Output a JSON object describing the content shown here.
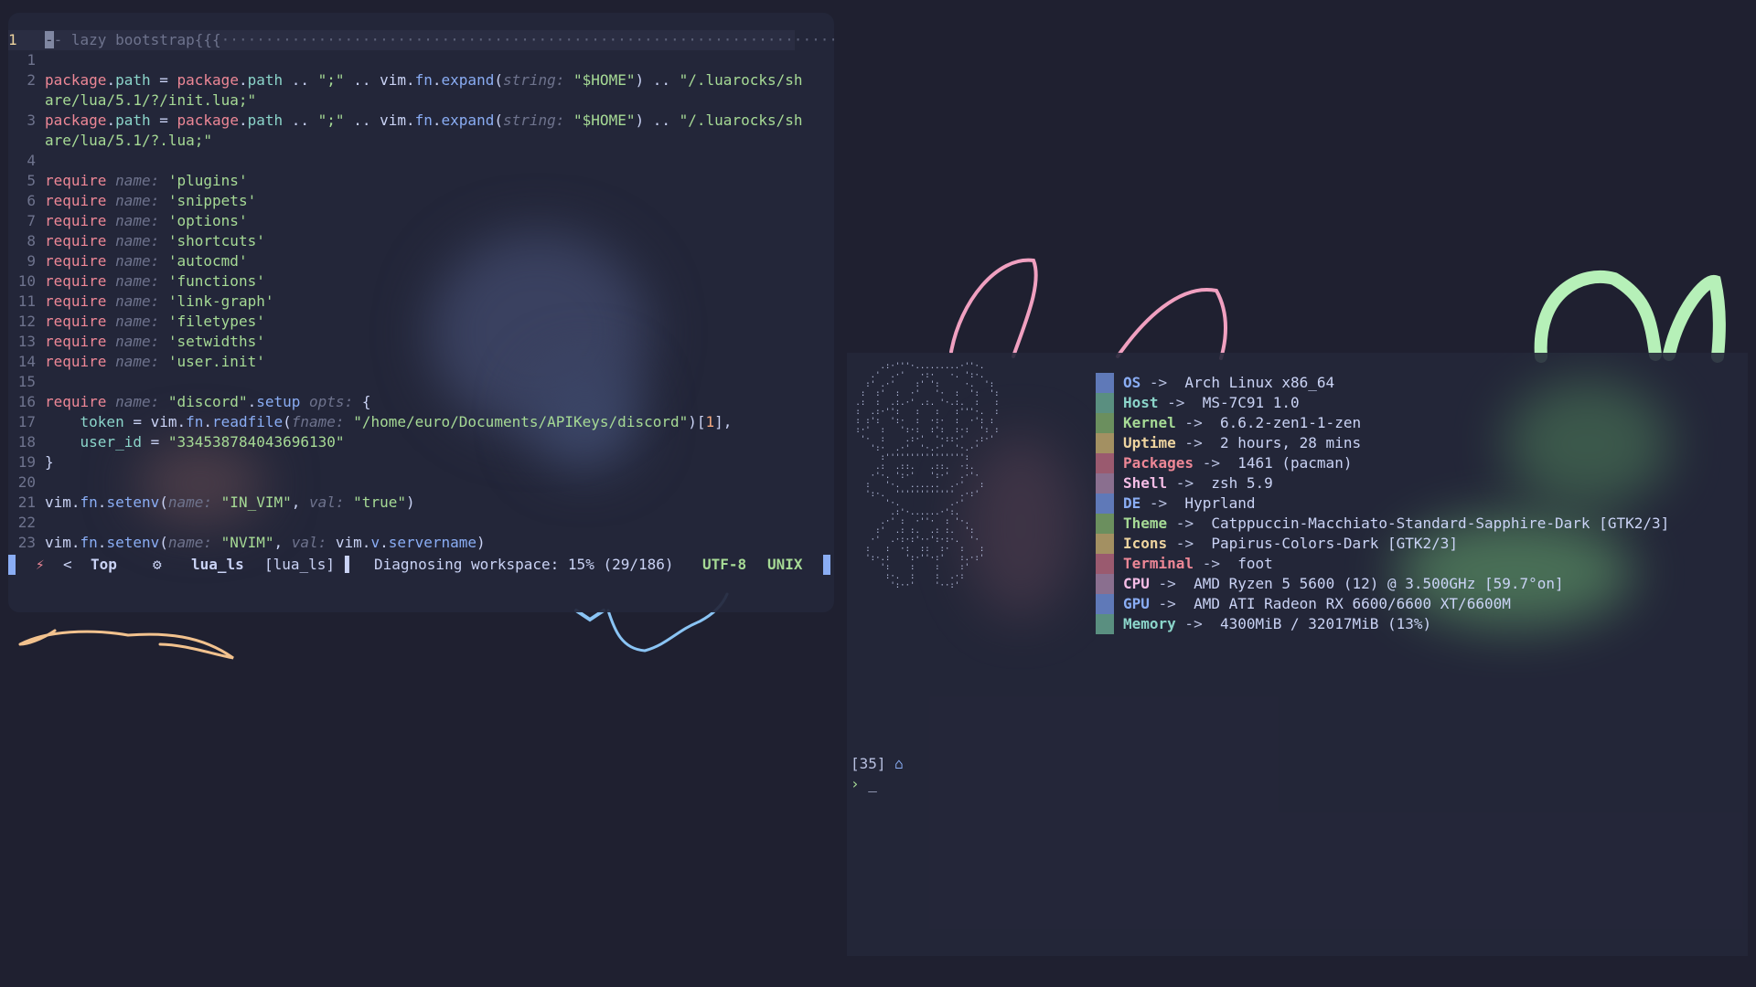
{
  "editor": {
    "lines": [
      {
        "n": "1",
        "current": true,
        "parts": [
          [
            "cursor",
            "-"
          ],
          [
            "cmt",
            "- lazy bootstrap{{{"
          ],
          [
            "dots",
            "·······································································"
          ]
        ]
      },
      {
        "n": "1",
        "parts": []
      },
      {
        "n": "2",
        "parts": [
          [
            "kw",
            "package"
          ],
          [
            "var",
            "."
          ],
          [
            "field",
            "path"
          ],
          [
            "var",
            " = "
          ],
          [
            "kw",
            "package"
          ],
          [
            "var",
            "."
          ],
          [
            "field",
            "path"
          ],
          [
            "var",
            " .. "
          ],
          [
            "str",
            "\";\""
          ],
          [
            "var",
            " .. vim."
          ],
          [
            "fn",
            "fn"
          ],
          [
            "var",
            "."
          ],
          [
            "fn",
            "expand"
          ],
          [
            "var",
            "("
          ],
          [
            "hint",
            "string: "
          ],
          [
            "str",
            "\"$HOME\""
          ],
          [
            "var",
            ") .. "
          ],
          [
            "str",
            "\"/.luarocks/sh"
          ]
        ]
      },
      {
        "n": "",
        "parts": [
          [
            "str",
            "are/lua/5.1/?/init.lua;\""
          ]
        ]
      },
      {
        "n": "3",
        "parts": [
          [
            "kw",
            "package"
          ],
          [
            "var",
            "."
          ],
          [
            "field",
            "path"
          ],
          [
            "var",
            " = "
          ],
          [
            "kw",
            "package"
          ],
          [
            "var",
            "."
          ],
          [
            "field",
            "path"
          ],
          [
            "var",
            " .. "
          ],
          [
            "str",
            "\";\""
          ],
          [
            "var",
            " .. vim."
          ],
          [
            "fn",
            "fn"
          ],
          [
            "var",
            "."
          ],
          [
            "fn",
            "expand"
          ],
          [
            "var",
            "("
          ],
          [
            "hint",
            "string: "
          ],
          [
            "str",
            "\"$HOME\""
          ],
          [
            "var",
            ") .. "
          ],
          [
            "str",
            "\"/.luarocks/sh"
          ]
        ]
      },
      {
        "n": "",
        "parts": [
          [
            "str",
            "are/lua/5.1/?.lua;\""
          ]
        ]
      },
      {
        "n": "4",
        "parts": []
      },
      {
        "n": "5",
        "parts": [
          [
            "kw",
            "require"
          ],
          [
            "var",
            " "
          ],
          [
            "hint",
            "name: "
          ],
          [
            "str",
            "'plugins'"
          ]
        ]
      },
      {
        "n": "6",
        "parts": [
          [
            "kw",
            "require"
          ],
          [
            "var",
            " "
          ],
          [
            "hint",
            "name: "
          ],
          [
            "str",
            "'snippets'"
          ]
        ]
      },
      {
        "n": "7",
        "parts": [
          [
            "kw",
            "require"
          ],
          [
            "var",
            " "
          ],
          [
            "hint",
            "name: "
          ],
          [
            "str",
            "'options'"
          ]
        ]
      },
      {
        "n": "8",
        "parts": [
          [
            "kw",
            "require"
          ],
          [
            "var",
            " "
          ],
          [
            "hint",
            "name: "
          ],
          [
            "str",
            "'shortcuts'"
          ]
        ]
      },
      {
        "n": "9",
        "parts": [
          [
            "kw",
            "require"
          ],
          [
            "var",
            " "
          ],
          [
            "hint",
            "name: "
          ],
          [
            "str",
            "'autocmd'"
          ]
        ]
      },
      {
        "n": "10",
        "parts": [
          [
            "kw",
            "require"
          ],
          [
            "var",
            " "
          ],
          [
            "hint",
            "name: "
          ],
          [
            "str",
            "'functions'"
          ]
        ]
      },
      {
        "n": "11",
        "parts": [
          [
            "kw",
            "require"
          ],
          [
            "var",
            " "
          ],
          [
            "hint",
            "name: "
          ],
          [
            "str",
            "'link-graph'"
          ]
        ]
      },
      {
        "n": "12",
        "parts": [
          [
            "kw",
            "require"
          ],
          [
            "var",
            " "
          ],
          [
            "hint",
            "name: "
          ],
          [
            "str",
            "'filetypes'"
          ]
        ]
      },
      {
        "n": "13",
        "parts": [
          [
            "kw",
            "require"
          ],
          [
            "var",
            " "
          ],
          [
            "hint",
            "name: "
          ],
          [
            "str",
            "'setwidths'"
          ]
        ]
      },
      {
        "n": "14",
        "parts": [
          [
            "kw",
            "require"
          ],
          [
            "var",
            " "
          ],
          [
            "hint",
            "name: "
          ],
          [
            "str",
            "'user.init'"
          ]
        ]
      },
      {
        "n": "15",
        "parts": []
      },
      {
        "n": "16",
        "parts": [
          [
            "kw",
            "require"
          ],
          [
            "var",
            " "
          ],
          [
            "hint",
            "name: "
          ],
          [
            "str",
            "\"discord\""
          ],
          [
            "var",
            "."
          ],
          [
            "fn",
            "setup"
          ],
          [
            "var",
            " "
          ],
          [
            "hint",
            "opts: "
          ],
          [
            "var",
            "{"
          ]
        ]
      },
      {
        "n": "17",
        "parts": [
          [
            "var",
            "    "
          ],
          [
            "field",
            "token"
          ],
          [
            "var",
            " = vim."
          ],
          [
            "fn",
            "fn"
          ],
          [
            "var",
            "."
          ],
          [
            "fn",
            "readfile"
          ],
          [
            "var",
            "("
          ],
          [
            "hint",
            "fname: "
          ],
          [
            "str",
            "\"/home/euro/Documents/APIKeys/discord\""
          ],
          [
            "var",
            ")["
          ],
          [
            "num",
            "1"
          ],
          [
            "var",
            "],"
          ]
        ]
      },
      {
        "n": "18",
        "parts": [
          [
            "var",
            "    "
          ],
          [
            "field",
            "user_id"
          ],
          [
            "var",
            " = "
          ],
          [
            "str",
            "\"334538784043696130\""
          ]
        ]
      },
      {
        "n": "19",
        "parts": [
          [
            "var",
            "}"
          ]
        ]
      },
      {
        "n": "20",
        "parts": []
      },
      {
        "n": "21",
        "parts": [
          [
            "var",
            "vim."
          ],
          [
            "fn",
            "fn"
          ],
          [
            "var",
            "."
          ],
          [
            "fn",
            "setenv"
          ],
          [
            "var",
            "("
          ],
          [
            "hint",
            "name: "
          ],
          [
            "str",
            "\"IN_VIM\""
          ],
          [
            "var",
            ", "
          ],
          [
            "hint",
            "val: "
          ],
          [
            "str",
            "\"true\""
          ],
          [
            "var",
            ")"
          ]
        ]
      },
      {
        "n": "22",
        "parts": []
      },
      {
        "n": "23",
        "parts": [
          [
            "var",
            "vim."
          ],
          [
            "fn",
            "fn"
          ],
          [
            "var",
            "."
          ],
          [
            "fn",
            "setenv"
          ],
          [
            "var",
            "("
          ],
          [
            "hint",
            "name: "
          ],
          [
            "str",
            "\"NVIM\""
          ],
          [
            "var",
            ", "
          ],
          [
            "hint",
            "val: "
          ],
          [
            "var",
            "vim."
          ],
          [
            "fn",
            "v"
          ],
          [
            "var",
            "."
          ],
          [
            "fn",
            "servername"
          ],
          [
            "var",
            ")"
          ]
        ]
      }
    ],
    "status": {
      "mode_icon": "⚡",
      "arrow": "<",
      "position": "Top",
      "gear_icon": "⚙",
      "lsp_name": "lua_ls",
      "lsp_bracket": "[lua_ls]",
      "block": "▌",
      "diagnosing": "Diagnosing workspace: 15% (29/186)",
      "encoding": "UTF-8",
      "format": "UNIX"
    }
  },
  "terminal": {
    "ascii_art": "      .:·'''·.........·''·.\n    .'  .·'   ·:·   ·. ':·.\n   :' .·'    :' ':     ·.  ':\n  :  :'  :  ·'   '·  :  ':  ':\n .:  :  .:.·' .:. '·.:.  :   :\n :  .:·'':   :   :   :'''·.  :\n : :':  ':·  :  ·:·  :  ·': :\n :·'  :   ':·:  :':  :·:  ': :\n  '·  :    .:·'  '·::·'  .:·'\n    ':·  .·'  '·.·'  '·.·'\n      :'''''''''''''''':\n     .:  .::.   .::.  ·:.\n    ·'·. ':·'   ':·'  .·'·\n   :   '·.  ......  .·'   :\n   ':·.  '''''''''''' .·:'\n       '·.          .·'\n        .:'·......·':.\n      .·' :  ·''·  : '·.\n     :'  .: :.  .: :.  ':\n    ·'  .·:·:'··':·:·.  '·\n   :   :  ·:  ::  :·  :   :\n   ':·.:   ':·''·:'   :.·:'\n      ':    :    :    :'\n       :·.  :    :  .·:\n        ':··'    '··:'",
    "info": [
      {
        "key": "OS",
        "sep": " -> ",
        "value": " Arch Linux x86_64",
        "color": "#5f79b8"
      },
      {
        "key": "Host",
        "sep": " -> ",
        "value": " MS-7C91 1.0",
        "color": "#5a8f80"
      },
      {
        "key": "Kernel",
        "sep": " -> ",
        "value": " 6.6.2-zen1-1-zen",
        "color": "#6b8f5e"
      },
      {
        "key": "Uptime",
        "sep": " -> ",
        "value": " 2 hours, 28 mins",
        "color": "#a39062"
      },
      {
        "key": "Packages",
        "sep": " -> ",
        "value": " 1461 (pacman)",
        "color": "#9a5a6f"
      },
      {
        "key": "Shell",
        "sep": " -> ",
        "value": " zsh 5.9",
        "color": "#8a6f8f"
      },
      {
        "key": "DE",
        "sep": " -> ",
        "value": " Hyprland",
        "color": "#5f79b8"
      },
      {
        "key": "Theme",
        "sep": " -> ",
        "value": " Catppuccin-Macchiato-Standard-Sapphire-Dark [GTK2/3]",
        "color": "#6b8f5e"
      },
      {
        "key": "Icons",
        "sep": " -> ",
        "value": " Papirus-Colors-Dark [GTK2/3]",
        "color": "#a39062"
      },
      {
        "key": "Terminal",
        "sep": " -> ",
        "value": " foot",
        "color": "#9a5a6f"
      },
      {
        "key": "CPU",
        "sep": " -> ",
        "value": " AMD Ryzen 5 5600 (12) @ 3.500GHz [59.7°on]",
        "color": "#8a6f8f"
      },
      {
        "key": "GPU",
        "sep": " -> ",
        "value": " AMD ATI Radeon RX 6600/6600 XT/6600M",
        "color": "#5f79b8"
      },
      {
        "key": "Memory",
        "sep": " -> ",
        "value": " 4300MiB / 32017MiB (13%)",
        "color": "#5a8f80"
      }
    ],
    "key_colors": {
      "OS": "#8aadf4",
      "Host": "#8bd5ca",
      "Kernel": "#a6da95",
      "Uptime": "#eed49f",
      "Packages": "#ed8796",
      "Shell": "#f5bde6",
      "DE": "#8aadf4",
      "Theme": "#a6da95",
      "Icons": "#eed49f",
      "Terminal": "#ed8796",
      "CPU": "#f5bde6",
      "GPU": "#8aadf4",
      "Memory": "#8bd5ca"
    },
    "prompt_count": "[35]",
    "home_icon": "⌂",
    "prompt_symbol": "›",
    "prompt_cursor": "_"
  }
}
